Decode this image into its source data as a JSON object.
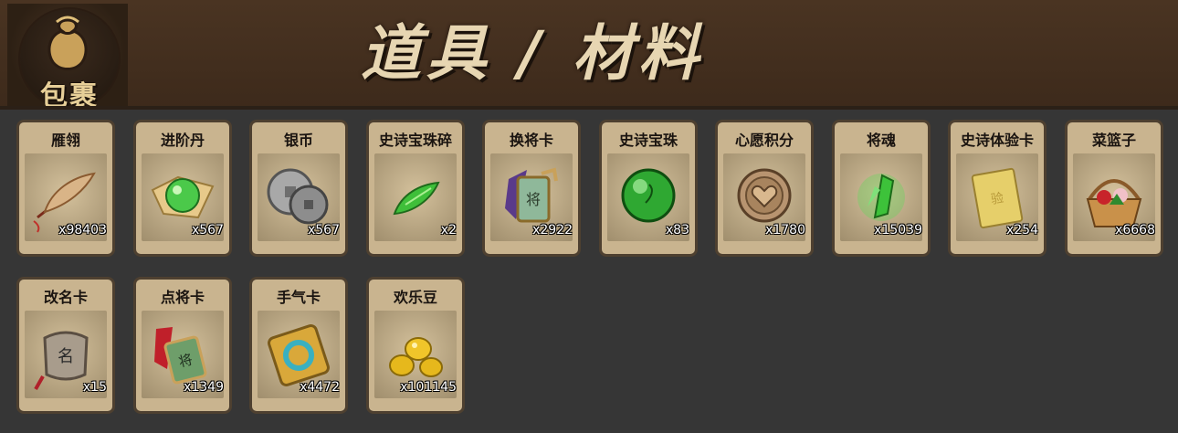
{
  "header": {
    "bag_label": "包裹",
    "title": "道具 / 材料"
  },
  "items": [
    {
      "name": "雁翎",
      "count": "x98403"
    },
    {
      "name": "进阶丹",
      "count": "x567"
    },
    {
      "name": "银币",
      "count": "x567"
    },
    {
      "name": "史诗宝珠碎",
      "count": "x2"
    },
    {
      "name": "换将卡",
      "count": "x2922"
    },
    {
      "name": "史诗宝珠",
      "count": "x83"
    },
    {
      "name": "心愿积分",
      "count": "x1780"
    },
    {
      "name": "将魂",
      "count": "x15039"
    },
    {
      "name": "史诗体验卡",
      "count": "x254"
    },
    {
      "name": "菜篮子",
      "count": "x6668"
    },
    {
      "name": "改名卡",
      "count": "x15"
    },
    {
      "name": "点将卡",
      "count": "x1349"
    },
    {
      "name": "手气卡",
      "count": "x4472"
    },
    {
      "name": "欢乐豆",
      "count": "x101145"
    }
  ],
  "icons": [
    "feather-icon",
    "green-pill-icon",
    "silver-coin-icon",
    "gem-shard-icon",
    "swap-card-icon",
    "green-orb-icon",
    "heart-coin-icon",
    "green-crystal-icon",
    "gold-card-icon",
    "basket-icon",
    "name-tag-icon",
    "recruit-card-icon",
    "luck-card-icon",
    "gold-beans-icon"
  ],
  "colors": {
    "header_bg": "#4a3422",
    "page_bg": "#363636",
    "slot_bg": "#c9b48f",
    "title": "#e7d6b2"
  }
}
